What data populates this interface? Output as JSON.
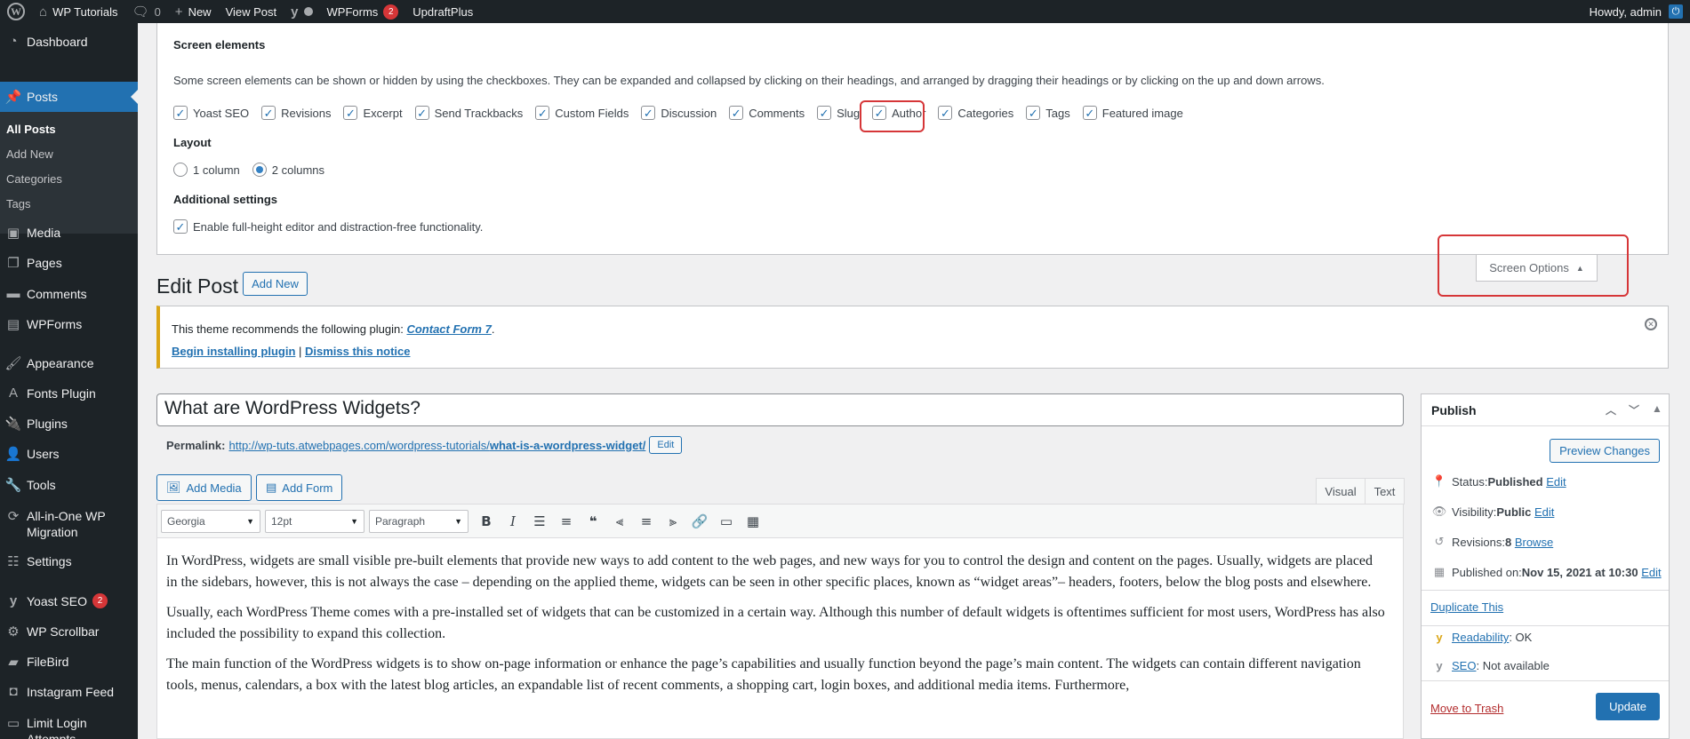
{
  "adminbar": {
    "site_name": "WP Tutorials",
    "comments_count": "0",
    "new_label": "New",
    "view_post": "View Post",
    "wpforms": "WPForms",
    "wpforms_badge": "2",
    "updraft": "UpdraftPlus",
    "howdy": "Howdy, admin"
  },
  "sidebar": {
    "dashboard": "Dashboard",
    "posts": "Posts",
    "sub": [
      "All Posts",
      "Add New",
      "Categories",
      "Tags"
    ],
    "media": "Media",
    "pages": "Pages",
    "comments": "Comments",
    "wpforms": "WPForms",
    "appearance": "Appearance",
    "fonts_plugin": "Fonts Plugin",
    "plugins": "Plugins",
    "users": "Users",
    "tools": "Tools",
    "migration_1": "All-in-One WP",
    "migration_2": "Migration",
    "settings": "Settings",
    "yoast": "Yoast SEO",
    "yoast_badge": "2",
    "scrollbar": "WP Scrollbar",
    "filebird": "FileBird",
    "instagram": "Instagram Feed",
    "limit_login_1": "Limit Login",
    "limit_login_2": "Attempts"
  },
  "screen_options": {
    "elements_heading": "Screen elements",
    "description": "Some screen elements can be shown or hidden by using the checkboxes. They can be expanded and collapsed by clicking on their headings, and arranged by dragging their headings or by clicking on the up and down arrows.",
    "checkboxes": [
      "Yoast SEO",
      "Revisions",
      "Excerpt",
      "Send Trackbacks",
      "Custom Fields",
      "Discussion",
      "Comments",
      "Slug",
      "Author",
      "Categories",
      "Tags",
      "Featured image"
    ],
    "layout_heading": "Layout",
    "layout_1": "1 column",
    "layout_2": "2 columns",
    "additional_heading": "Additional settings",
    "fullheight": "Enable full-height editor and distraction-free functionality.",
    "tab_label": "Screen Options"
  },
  "page": {
    "title": "Edit Post",
    "add_new": "Add New"
  },
  "notice": {
    "text": "This theme recommends the following plugin: ",
    "plugin": "Contact Form 7",
    "period": ".",
    "begin": "Begin installing plugin",
    "sep": " | ",
    "dismiss": "Dismiss this notice"
  },
  "post": {
    "title": "What are WordPress Widgets?",
    "permalink_label": "Permalink:",
    "permalink_base": "http://wp-tuts.atwebpages.com/wordpress-tutorials/",
    "permalink_slug": "what-is-a-wordpress-widget/",
    "permalink_edit": "Edit"
  },
  "editor": {
    "add_media": "Add Media",
    "add_form": "Add Form",
    "tab_visual": "Visual",
    "tab_text": "Text",
    "font": "Georgia",
    "size": "12pt",
    "format": "Paragraph",
    "paragraphs": [
      "In WordPress, widgets are small visible pre-built elements that provide new ways to add content to the web pages, and new ways for you to control the design and content on the pages. Usually, widgets are placed in the sidebars, however, this is not always the case – depending on the applied theme, widgets can be seen in other specific places, known as “widget areas”– headers, footers, below the blog posts and elsewhere.",
      "Usually, each WordPress Theme comes with a pre-installed set of widgets that can be customized in a certain way. Although this number of default widgets is oftentimes sufficient for most users, WordPress has also included the possibility to expand this collection.",
      "The main function of the WordPress widgets is to show on-page information or enhance the page’s capabilities and usually function beyond the page’s main content. The widgets can contain different navigation tools, menus, calendars, a box with the latest blog articles, an expandable list of recent comments, a shopping cart, login boxes, and additional media items. Furthermore,"
    ]
  },
  "publish": {
    "heading": "Publish",
    "preview": "Preview Changes",
    "status_label": "Status: ",
    "status_value": "Published",
    "visibility_label": "Visibility: ",
    "visibility_value": "Public",
    "revisions_label": "Revisions: ",
    "revisions_value": "8",
    "browse": "Browse",
    "published_label": "Published on: ",
    "published_value": "Nov 15, 2021 at 10:30",
    "edit": "Edit",
    "duplicate": "Duplicate This",
    "readability_label": "Readability",
    "readability_value": ": OK",
    "seo_label": "SEO",
    "seo_value": ": Not available",
    "trash": "Move to Trash",
    "update": "Update"
  },
  "colors": {
    "accent": "#2271b1",
    "adminbar": "#1d2327",
    "highlight_box": "#d63638",
    "notice_border": "#dba617"
  }
}
